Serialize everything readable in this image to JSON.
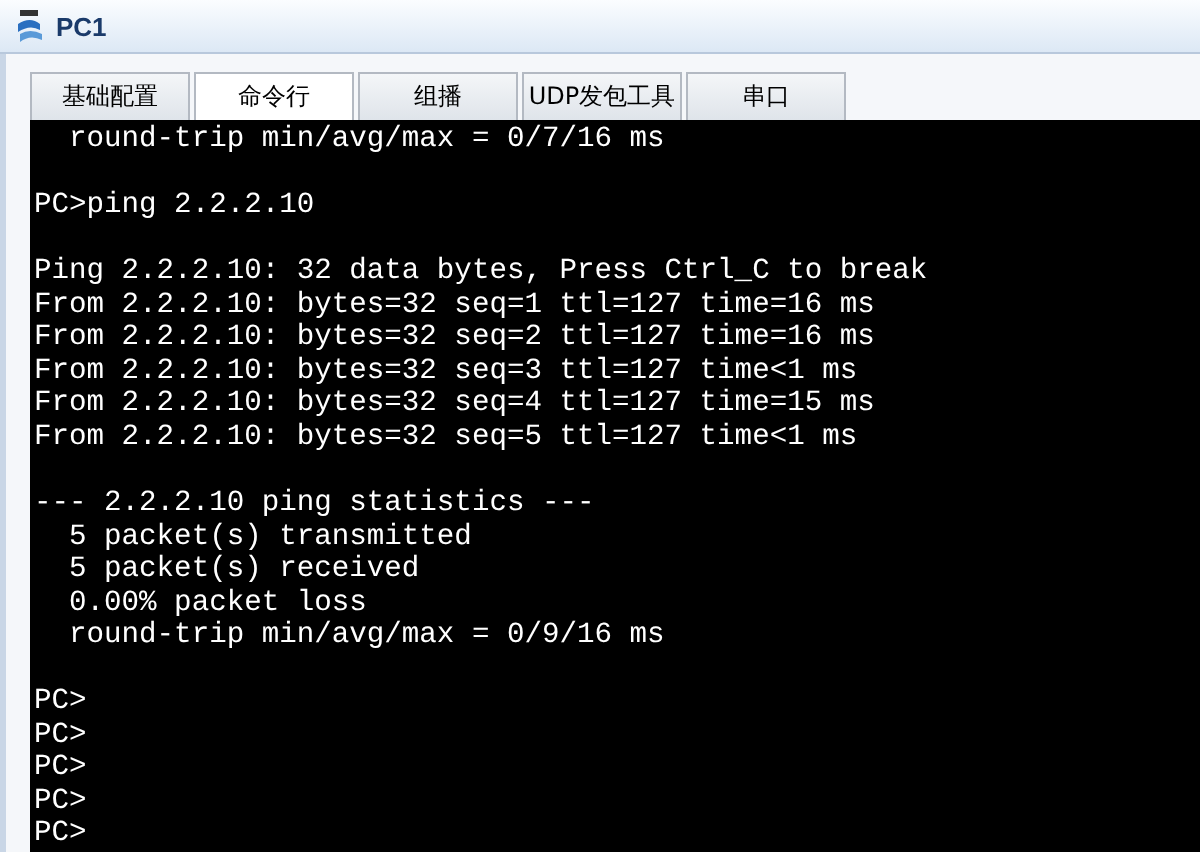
{
  "window": {
    "title": "PC1"
  },
  "tabs": [
    {
      "label": "基础配置",
      "selected": false
    },
    {
      "label": "命令行",
      "selected": true
    },
    {
      "label": "组播",
      "selected": false
    },
    {
      "label": "UDP发包工具",
      "selected": false
    },
    {
      "label": "串口",
      "selected": false
    }
  ],
  "terminal": {
    "blocks": [
      [
        "  round-trip min/avg/max = 0/7/16 ms"
      ],
      [
        "PC>ping 2.2.2.10"
      ],
      [
        "Ping 2.2.2.10: 32 data bytes, Press Ctrl_C to break",
        "From 2.2.2.10: bytes=32 seq=1 ttl=127 time=16 ms",
        "From 2.2.2.10: bytes=32 seq=2 ttl=127 time=16 ms",
        "From 2.2.2.10: bytes=32 seq=3 ttl=127 time<1 ms",
        "From 2.2.2.10: bytes=32 seq=4 ttl=127 time=15 ms",
        "From 2.2.2.10: bytes=32 seq=5 ttl=127 time<1 ms"
      ],
      [
        "--- 2.2.2.10 ping statistics ---",
        "  5 packet(s) transmitted",
        "  5 packet(s) received",
        "  0.00% packet loss",
        "  round-trip min/avg/max = 0/9/16 ms"
      ],
      [
        "PC>",
        "PC>",
        "PC>",
        "PC>",
        "PC>"
      ]
    ]
  }
}
